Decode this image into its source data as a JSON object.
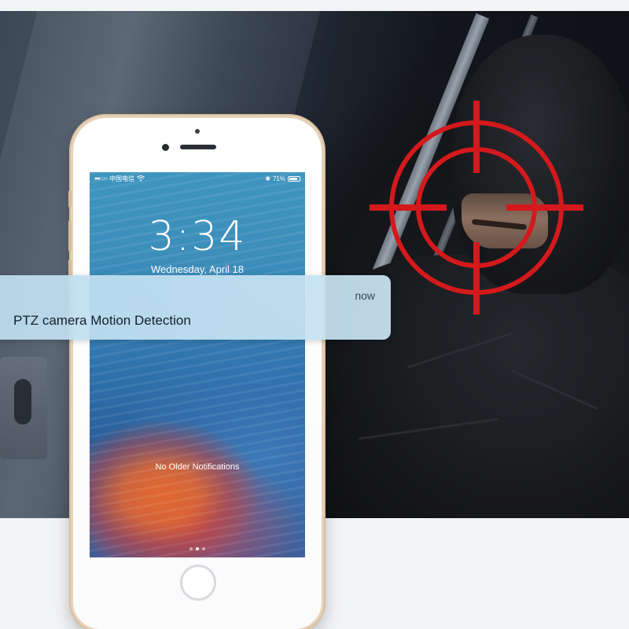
{
  "notification": {
    "time": "now",
    "message": "PTZ camera Motion Detection"
  },
  "lock_screen": {
    "carrier": "中国电信",
    "battery_level": "71%",
    "time": "3:34",
    "date": "Wednesday, April 18",
    "no_older_text": "No Older Notifications",
    "page_count": 3,
    "active_page": 2
  },
  "colors": {
    "reticle": "#d4191c",
    "phone_frame": "#e7d2b8",
    "notification_bg": "#c3e0f1"
  },
  "icons": {
    "wifi": "wifi-icon",
    "bluetooth": "bluetooth-icon",
    "battery": "battery-icon",
    "target": "target-reticle-icon"
  }
}
